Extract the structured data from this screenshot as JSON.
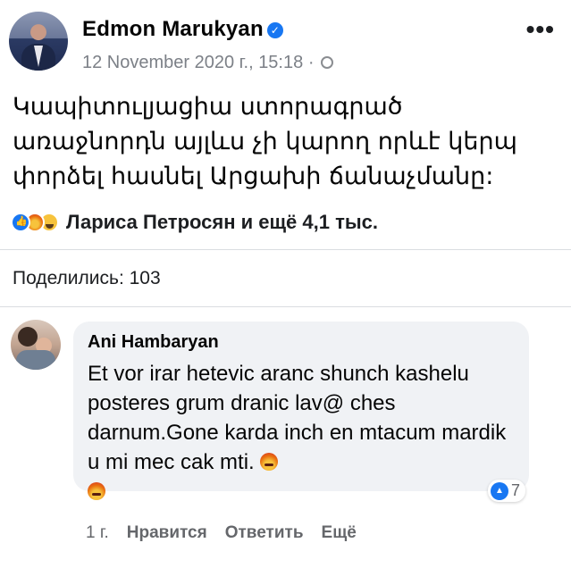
{
  "post": {
    "author": "Edmon Marukyan",
    "timestamp": "12 November 2020 г., 15:18",
    "meta_separator": "·",
    "text": "Կապիտուլյացիա ստորագրած առաջնորդն այլևս չի կարող որևէ կերպ փորձել հասնել Արցախի ճանաչմանը:",
    "reactions_summary": "Лариса Петросян и ещё 4,1 тыс.",
    "shares_text": "Поделились: 103"
  },
  "comment": {
    "author": "Ani Hambaryan",
    "text": "Et vor irar hetevic aranc shunch kashelu posteres grum dranic lav@ ches darnum.Gone karda inch en mtacum mardik u mi mec cak mti.",
    "like_count": "7",
    "time": "1 г.",
    "like_label": "Нравится",
    "reply_label": "Ответить",
    "more_label": "Ещё"
  },
  "icons": {
    "verified": "verified-badge-icon",
    "privacy": "globe-icon",
    "more": "more-options-icon",
    "like": "like-icon",
    "angry": "angry-emoji-icon",
    "haha": "haha-emoji-icon"
  },
  "colors": {
    "accent": "#1877f2",
    "meta_gray": "#65676b",
    "bubble_bg": "#f0f2f5"
  }
}
